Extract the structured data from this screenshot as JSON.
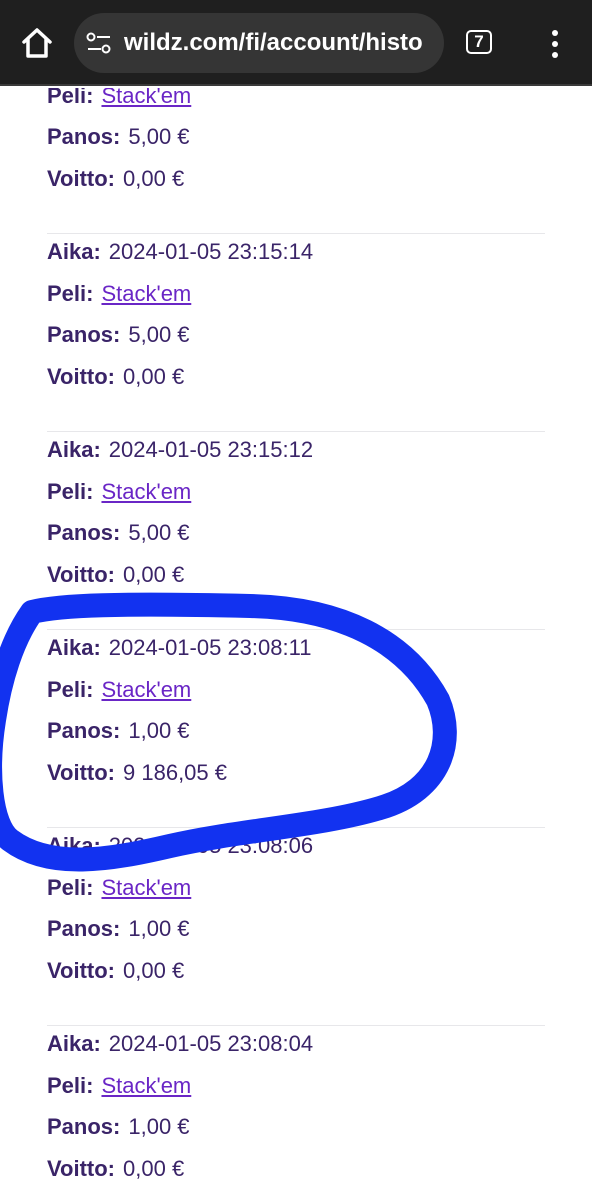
{
  "browser": {
    "url": "wildz.com/fi/account/histo",
    "tab_count": "7",
    "icons": [
      "home-icon",
      "site-settings-icon",
      "tab-switcher-icon",
      "more-vert-icon"
    ]
  },
  "labels": {
    "time": "Aika:",
    "game": "Peli:",
    "bet": "Panos:",
    "win": "Voitto:"
  },
  "history": [
    {
      "aika": "",
      "peli": "Stack'em",
      "panos": "5,00 €",
      "voitto": "0,00 €"
    },
    {
      "aika": "2024-01-05 23:15:14",
      "peli": "Stack'em",
      "panos": "5,00 €",
      "voitto": "0,00 €"
    },
    {
      "aika": "2024-01-05 23:15:12",
      "peli": "Stack'em",
      "panos": "5,00 €",
      "voitto": "0,00 €"
    },
    {
      "aika": "2024-01-05 23:08:11",
      "peli": "Stack'em",
      "panos": "1,00 €",
      "voitto": "9 186,05 €"
    },
    {
      "aika": "2024-01-05 23:08:06",
      "peli": "Stack'em",
      "panos": "1,00 €",
      "voitto": "0,00 €"
    },
    {
      "aika": "2024-01-05 23:08:04",
      "peli": "Stack'em",
      "panos": "1,00 €",
      "voitto": "0,00 €"
    }
  ],
  "colors": {
    "label": "#3a2468",
    "link": "#6a26c6",
    "annotation": "#1232f0",
    "topbar": "#1f1f1f"
  }
}
